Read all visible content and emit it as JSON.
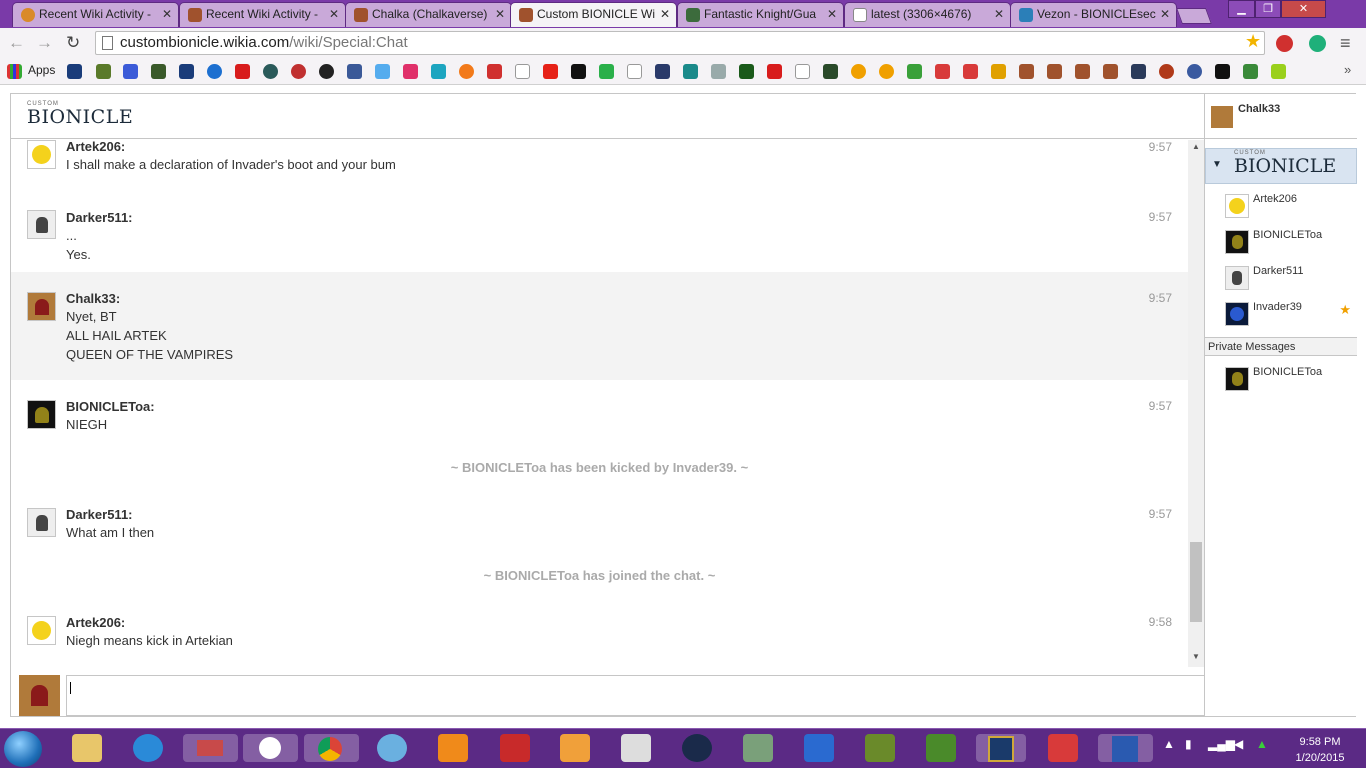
{
  "browser": {
    "tabs": [
      {
        "title": "Recent Wiki Activity -",
        "active": false
      },
      {
        "title": "Recent Wiki Activity -",
        "active": false
      },
      {
        "title": "Chalka (Chalkaverse)",
        "active": false
      },
      {
        "title": "Custom BIONICLE Wi",
        "active": true
      },
      {
        "title": "Fantastic Knight/Gua",
        "active": false
      },
      {
        "title": "latest (3306×4676)",
        "active": false
      },
      {
        "title": "Vezon - BIONICLEsec",
        "active": false
      }
    ],
    "url_domain": "custombionicle.wikia.com",
    "url_path": "/wiki/Special:Chat",
    "bookmarks_apps_label": "Apps"
  },
  "chat": {
    "logo_small": "CUSTOM",
    "logo_text": "BIONICLE",
    "current_user": "Chalk33",
    "messages": [
      {
        "user": "Artek206:",
        "time": "9:57",
        "lines": [
          "I shall make a declaration of Invader's boot and your bum"
        ]
      },
      {
        "user": "Darker511:",
        "time": "9:57",
        "lines": [
          "...",
          "Yes."
        ]
      },
      {
        "user": "Chalk33:",
        "time": "9:57",
        "lines": [
          "Nyet, BT",
          "ALL HAIL ARTEK",
          "QUEEN OF THE VAMPIRES"
        ]
      },
      {
        "user": "BIONICLEToa:",
        "time": "9:57",
        "lines": [
          "NIEGH"
        ]
      },
      {
        "user": "Darker511:",
        "time": "9:57",
        "lines": [
          "What am I then"
        ]
      },
      {
        "user": "Artek206:",
        "time": "9:58",
        "lines": [
          "Niegh means kick in Artekian"
        ]
      }
    ],
    "inline_alerts": [
      "~ BIONICLEToa has been kicked by Invader39. ~",
      "~ BIONICLEToa has joined the chat. ~"
    ],
    "input_value": ""
  },
  "sidebar": {
    "room_logo_small": "CUSTOM",
    "room_logo": "BIONICLE",
    "users": [
      {
        "name": "Artek206",
        "avatar": "smiley-avatar"
      },
      {
        "name": "BIONICLEToa",
        "avatar": "mask-avatar"
      },
      {
        "name": "Darker511",
        "avatar": "figure-avatar"
      },
      {
        "name": "Invader39",
        "avatar": "blue-avatar",
        "badge": "★"
      }
    ],
    "private_messages_label": "Private Messages",
    "private_users": [
      {
        "name": "BIONICLEToa",
        "avatar": "mask-avatar"
      }
    ]
  },
  "taskbar": {
    "clock_time": "9:58 PM",
    "clock_date": "1/20/2015"
  },
  "colors": {
    "window_frame": "#7a3aa8",
    "taskbar": "#5b2a85",
    "chat_border": "#c6c6c6",
    "room_header": "#d9e4f1"
  }
}
